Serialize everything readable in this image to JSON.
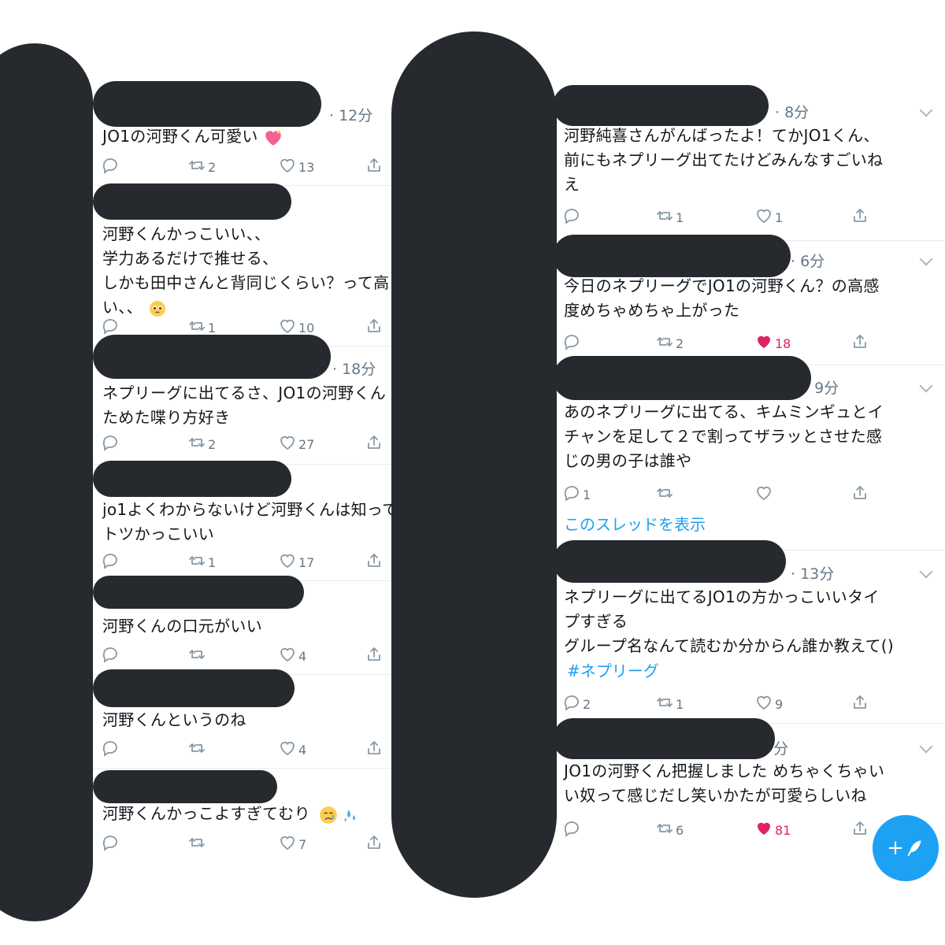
{
  "left_tweets": [
    {
      "time": "12分",
      "text": "JO1の河野くん可愛い",
      "emoji": "sparkling-heart",
      "actions": {
        "reply": "",
        "retweet": "2",
        "like": "13"
      }
    },
    {
      "time": "",
      "text": "河野くんかっこいい、、\n学力あるだけで推せる、\nしかも田中さんと背同じくらい？って高\nい、、",
      "emoji": "pleading-face",
      "actions": {
        "reply": "",
        "retweet": "1",
        "like": "10"
      }
    },
    {
      "time": "18分",
      "text": "ネプリーグに出てるさ、JO1の河野くん\nためた喋り方好き",
      "actions": {
        "reply": "",
        "retweet": "2",
        "like": "27"
      }
    },
    {
      "time": "",
      "text": "jo1よくわからないけど河野くんは知って\nトツかっこいい",
      "actions": {
        "reply": "",
        "retweet": "1",
        "like": "17"
      }
    },
    {
      "time": "",
      "text": "河野くんの口元がいい",
      "actions": {
        "reply": "",
        "retweet": "",
        "like": "4"
      }
    },
    {
      "time": "",
      "text": "河野くんというのね",
      "actions": {
        "reply": "",
        "retweet": "",
        "like": "4"
      }
    },
    {
      "time": "",
      "text": "河野くんかっこよすぎてむり",
      "emoji": "crying-face-sweat",
      "actions": {
        "reply": "",
        "retweet": "",
        "like": "7"
      }
    }
  ],
  "right_tweets": [
    {
      "time": "8分",
      "text": "河野純喜さんがんばったよ！てかJO1くん、\n前にもネプリーグ出てたけどみんなすごいね\nえ",
      "actions": {
        "reply": "",
        "retweet": "1",
        "like": "1"
      },
      "liked": false
    },
    {
      "time": "6分",
      "text": "今日のネプリーグでJO1の河野くん？の高感\n度めちゃめちゃ上がった",
      "actions": {
        "reply": "",
        "retweet": "2",
        "like": "18"
      },
      "liked": true
    },
    {
      "time": "9分",
      "text": "あのネプリーグに出てる、キムミンギュとイ\nチャンを足して２で割ってザラッとさせた感\nじの男の子は誰や",
      "actions": {
        "reply": "1",
        "retweet": "",
        "like": ""
      },
      "liked": false,
      "thread_link": "このスレッドを表示"
    },
    {
      "time": "13分",
      "text": "ネプリーグに出てるJO1の方かっこいいタイ\nプすぎる\nグループ名なんて読むか分からん誰か教えて()",
      "hashtag": "#ネプリーグ",
      "actions": {
        "reply": "2",
        "retweet": "1",
        "like": "9"
      },
      "liked": false
    },
    {
      "time": "分",
      "text": "JO1の河野くん把握しました めちゃくちゃい\nい奴って感じだし笑いかたが可愛らしいね",
      "actions": {
        "reply": "",
        "retweet": "6",
        "like": "81"
      },
      "liked": true
    }
  ],
  "fab": {
    "label": "+",
    "icon": "compose-feather-icon",
    "color": "#1da1f2"
  },
  "colors": {
    "accent": "#1da1f2",
    "like": "#e0245e",
    "muted": "#657786",
    "redaction": "#262a2e"
  }
}
